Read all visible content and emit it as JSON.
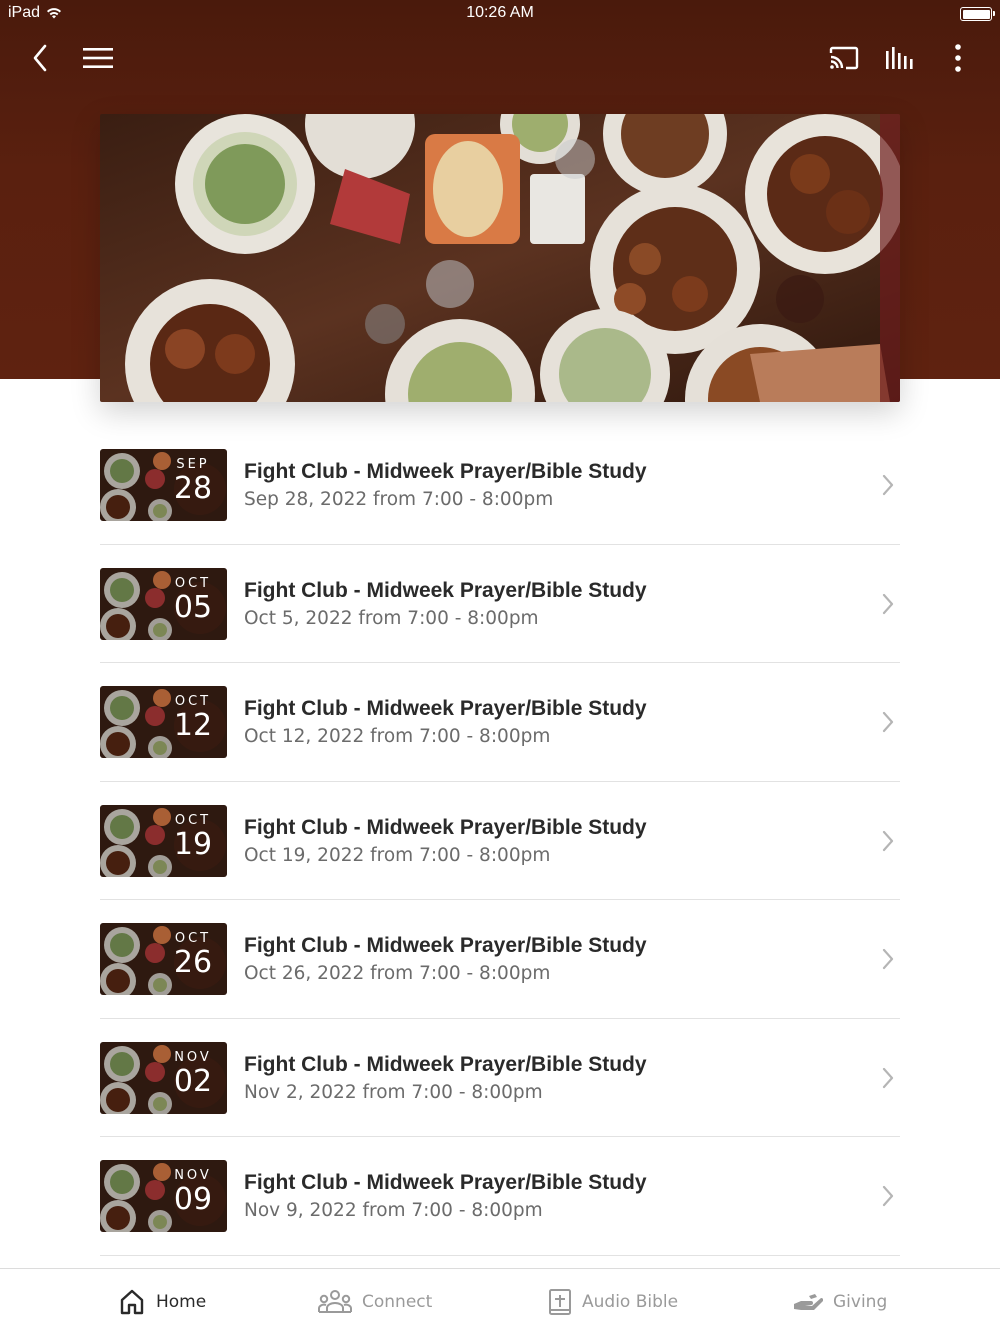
{
  "status_bar": {
    "device": "iPad",
    "time": "10:26 AM"
  },
  "navbar": {
    "back_icon": "chevron-left-icon",
    "menu_icon": "hamburger-menu-icon",
    "cast_icon": "cast-icon",
    "audio_icon": "audio-bars-icon",
    "more_icon": "more-vertical-icon"
  },
  "colors": {
    "header": "#5a200f",
    "title_text": "#2a2a2a",
    "subtitle_text": "#6b6b6b",
    "tab_inactive": "#9a9a9a"
  },
  "events": [
    {
      "month": "SEP",
      "day": "28",
      "title": "Fight Club - Midweek Prayer/Bible Study",
      "date": "Sep 28, 2022 from 7:00 - 8:00pm"
    },
    {
      "month": "OCT",
      "day": "05",
      "title": "Fight Club - Midweek Prayer/Bible Study",
      "date": "Oct 5, 2022 from 7:00 - 8:00pm"
    },
    {
      "month": "OCT",
      "day": "12",
      "title": "Fight Club - Midweek Prayer/Bible Study",
      "date": "Oct 12, 2022 from 7:00 - 8:00pm"
    },
    {
      "month": "OCT",
      "day": "19",
      "title": "Fight Club - Midweek Prayer/Bible Study",
      "date": "Oct 19, 2022 from 7:00 - 8:00pm"
    },
    {
      "month": "OCT",
      "day": "26",
      "title": "Fight Club - Midweek Prayer/Bible Study",
      "date": "Oct 26, 2022 from 7:00 - 8:00pm"
    },
    {
      "month": "NOV",
      "day": "02",
      "title": "Fight Club - Midweek Prayer/Bible Study",
      "date": "Nov 2, 2022 from 7:00 - 8:00pm"
    },
    {
      "month": "NOV",
      "day": "09",
      "title": "Fight Club - Midweek Prayer/Bible Study",
      "date": "Nov 9, 2022 from 7:00 - 8:00pm"
    }
  ],
  "tabs": [
    {
      "label": "Home",
      "icon": "home-icon",
      "active": true
    },
    {
      "label": "Connect",
      "icon": "people-icon",
      "active": false
    },
    {
      "label": "Audio Bible",
      "icon": "bible-icon",
      "active": false
    },
    {
      "label": "Giving",
      "icon": "giving-hand-icon",
      "active": false
    }
  ]
}
